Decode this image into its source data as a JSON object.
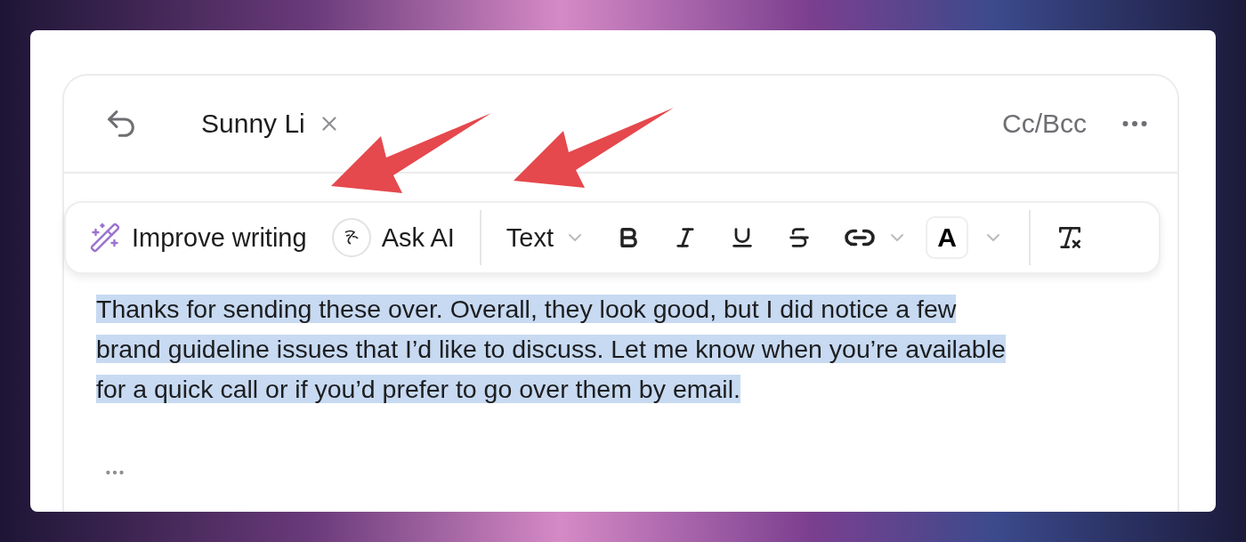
{
  "header": {
    "recipient": "Sunny Li",
    "cc_bcc": "Cc/Bcc"
  },
  "toolbar": {
    "improve": "Improve writing",
    "ask_ai": "Ask AI",
    "text_style": "Text",
    "font_color": "A"
  },
  "body": {
    "lines": [
      "Thanks for sending these over. Overall, they look good, but I did notice a few",
      "brand guideline issues that I’d like to discuss. Let me know when you’re available",
      "for a quick call or if you’d prefer to go over them by email."
    ],
    "selected": true
  },
  "annotations": [
    {
      "kind": "arrow"
    },
    {
      "kind": "arrow"
    }
  ]
}
